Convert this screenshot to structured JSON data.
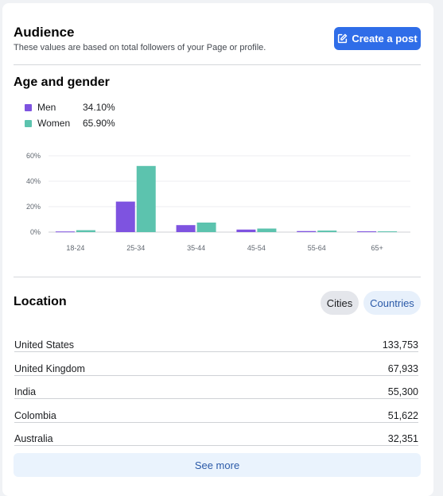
{
  "audience": {
    "title": "Audience",
    "subtitle": "These values are based on total followers of your Page or profile.",
    "create_post_label": "Create a post"
  },
  "age_gender": {
    "title": "Age and gender",
    "legend": [
      {
        "label": "Men",
        "value": "34.10%",
        "color": "#7e53e0"
      },
      {
        "label": "Women",
        "value": "65.90%",
        "color": "#5cc3ae"
      }
    ]
  },
  "chart_data": {
    "type": "bar",
    "categories": [
      "18-24",
      "25-34",
      "35-44",
      "45-54",
      "55-64",
      "65+"
    ],
    "series": [
      {
        "name": "Men",
        "values": [
          0.5,
          24,
          5.5,
          2,
          0.8,
          0.6
        ],
        "color": "#7e53e0"
      },
      {
        "name": "Women",
        "values": [
          1.5,
          52,
          7.5,
          2.8,
          1.2,
          0.6
        ],
        "color": "#5cc3ae"
      }
    ],
    "yticks": [
      "0%",
      "20%",
      "40%",
      "60%"
    ],
    "ylim": [
      0,
      60
    ],
    "grid": true
  },
  "location": {
    "title": "Location",
    "tabs": [
      {
        "label": "Cities",
        "selected": true
      },
      {
        "label": "Countries",
        "selected": false
      }
    ],
    "rows": [
      {
        "name": "United States",
        "value": "133,753"
      },
      {
        "name": "United Kingdom",
        "value": "67,933"
      },
      {
        "name": "India",
        "value": "55,300"
      },
      {
        "name": "Colombia",
        "value": "51,622"
      },
      {
        "name": "Australia",
        "value": "32,351"
      }
    ],
    "see_more_label": "See more"
  }
}
